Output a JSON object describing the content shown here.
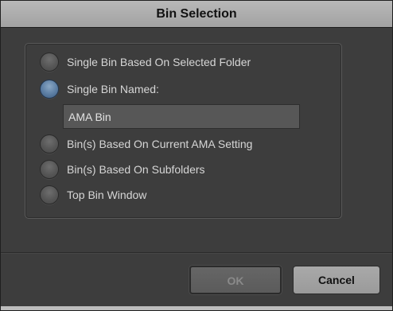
{
  "window": {
    "title": "Bin Selection"
  },
  "options": [
    {
      "label": "Single Bin Based On Selected Folder",
      "selected": false
    },
    {
      "label": "Single Bin Named:",
      "selected": true
    },
    {
      "label": "Bin(s) Based On Current AMA Setting",
      "selected": false
    },
    {
      "label": "Bin(s) Based On Subfolders",
      "selected": false
    },
    {
      "label": "Top Bin Window",
      "selected": false
    }
  ],
  "bin_name": {
    "value": "AMA Bin"
  },
  "buttons": {
    "ok": "OK",
    "cancel": "Cancel"
  },
  "colors": {
    "selected_radio": "#5f81a6",
    "titlebar": "#a9a9a9",
    "background": "#3d3d3d"
  }
}
